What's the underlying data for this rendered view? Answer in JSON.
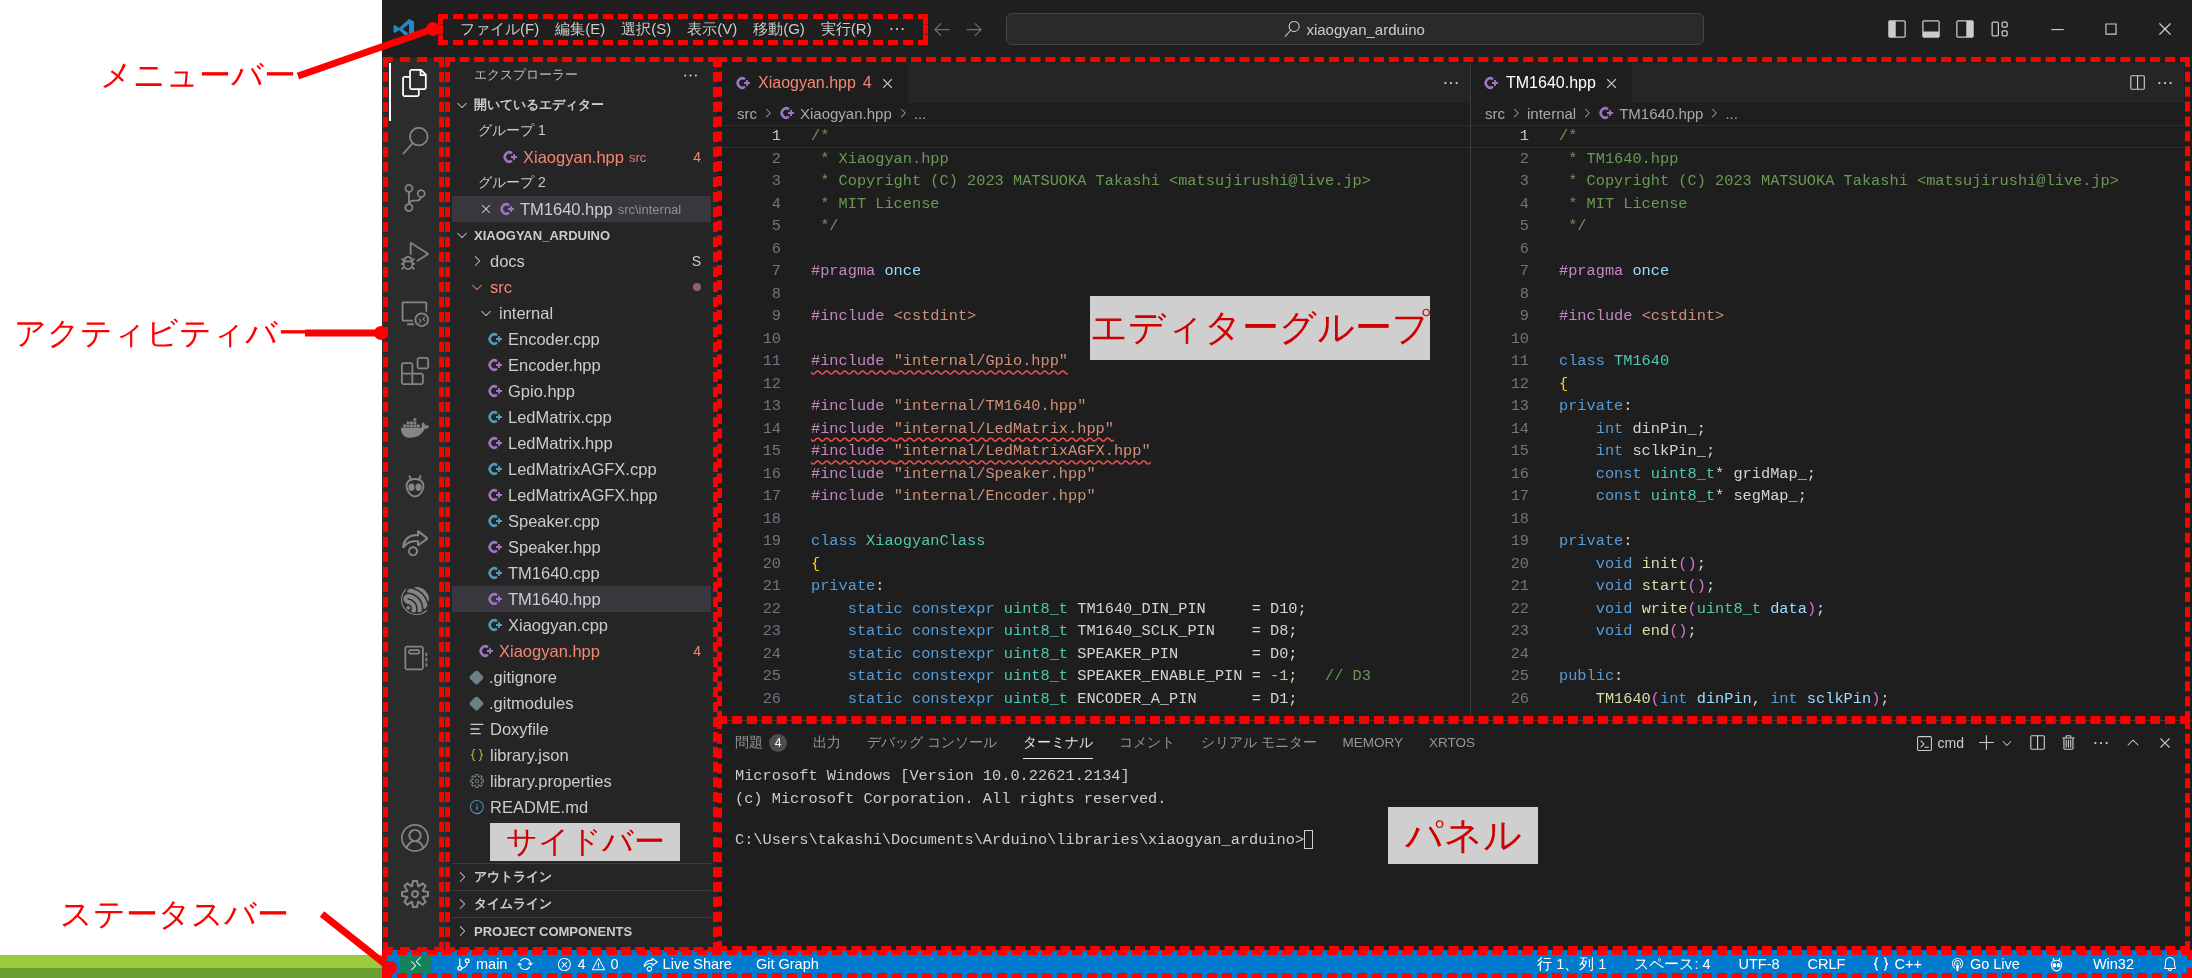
{
  "title_bar": {
    "menu": [
      "ファイル(F)",
      "編集(E)",
      "選択(S)",
      "表示(V)",
      "移動(G)",
      "実行(R)"
    ],
    "search": "xiaogyan_arduino"
  },
  "activity_bar": {
    "items": [
      {
        "kind": "files",
        "selected": true
      },
      {
        "kind": "search",
        "selected": false
      },
      {
        "kind": "scm",
        "selected": false
      },
      {
        "kind": "debug",
        "selected": false
      },
      {
        "kind": "remote",
        "selected": false
      },
      {
        "kind": "extensions",
        "selected": false
      },
      {
        "kind": "docker",
        "selected": false
      },
      {
        "kind": "alien",
        "selected": false
      },
      {
        "kind": "liveshare",
        "selected": false
      },
      {
        "kind": "esp",
        "selected": false
      },
      {
        "kind": "notebook",
        "selected": false
      }
    ],
    "bottom": [
      {
        "kind": "account"
      },
      {
        "kind": "settings"
      }
    ]
  },
  "sidebar": {
    "title": "エクスプローラー",
    "open_editors": {
      "label": "開いているエディター",
      "expanded": true,
      "groups": [
        {
          "label": "グループ 1",
          "files": [
            {
              "name": "Xiaogyan.hpp",
              "kind": "hpp",
              "path": "src",
              "badge": "4",
              "error": true,
              "selected": false
            }
          ]
        },
        {
          "label": "グループ 2",
          "files": [
            {
              "name": "TM1640.hpp",
              "kind": "hpp",
              "path": "src\\internal",
              "error": false,
              "selected": true
            }
          ]
        }
      ]
    },
    "folder": {
      "label": "XIAOGYAN_ARDUINO",
      "expanded": true,
      "children": [
        {
          "name": "docs",
          "kind": "folder",
          "expanded": false,
          "modified": false,
          "error": false,
          "selected": false,
          "badge": "S"
        },
        {
          "name": "src",
          "kind": "folder",
          "expanded": true,
          "modified": true,
          "error": true,
          "selected": false,
          "children": [
            {
              "name": "internal",
              "kind": "folder",
              "expanded": true,
              "modified": false,
              "error": false,
              "selected": false,
              "children": [
                {
                  "name": "Encoder.cpp",
                  "kind": "cpp",
                  "error": false,
                  "selected": false
                },
                {
                  "name": "Encoder.hpp",
                  "kind": "hpp",
                  "error": false,
                  "selected": false
                },
                {
                  "name": "Gpio.hpp",
                  "kind": "hpp",
                  "error": false,
                  "selected": false
                },
                {
                  "name": "LedMatrix.cpp",
                  "kind": "cpp",
                  "error": false,
                  "selected": false
                },
                {
                  "name": "LedMatrix.hpp",
                  "kind": "hpp",
                  "error": false,
                  "selected": false
                },
                {
                  "name": "LedMatrixAGFX.cpp",
                  "kind": "cpp",
                  "error": false,
                  "selected": false
                },
                {
                  "name": "LedMatrixAGFX.hpp",
                  "kind": "hpp",
                  "error": false,
                  "selected": false
                },
                {
                  "name": "Speaker.cpp",
                  "kind": "cpp",
                  "error": false,
                  "selected": false
                },
                {
                  "name": "Speaker.hpp",
                  "kind": "hpp",
                  "error": false,
                  "selected": false
                },
                {
                  "name": "TM1640.cpp",
                  "kind": "cpp",
                  "error": false,
                  "selected": false
                },
                {
                  "name": "TM1640.hpp",
                  "kind": "hpp",
                  "error": false,
                  "selected": true
                },
                {
                  "name": "Xiaogyan.cpp",
                  "kind": "cpp",
                  "error": false,
                  "selected": false
                }
              ]
            },
            {
              "name": "Xiaogyan.hpp",
              "kind": "hpp",
              "error": true,
              "selected": false,
              "badge": "4"
            }
          ]
        },
        {
          "name": ".gitignore",
          "kind": "git",
          "error": false,
          "selected": false
        },
        {
          "name": ".gitmodules",
          "kind": "git",
          "error": false,
          "selected": false
        },
        {
          "name": "Doxyfile",
          "kind": "doc",
          "error": false,
          "selected": false
        },
        {
          "name": "library.json",
          "kind": "json",
          "error": false,
          "selected": false
        },
        {
          "name": "library.properties",
          "kind": "props",
          "error": false,
          "selected": false
        },
        {
          "name": "README.md",
          "kind": "md",
          "error": false,
          "selected": false
        }
      ]
    },
    "sections": [
      {
        "label": "アウトライン",
        "expanded": false
      },
      {
        "label": "タイムライン",
        "expanded": false
      },
      {
        "label": "PROJECT COMPONENTS",
        "expanded": false
      }
    ]
  },
  "editors": [
    {
      "tab": {
        "label": "Xiaogyan.hpp",
        "badge": "4",
        "kind": "hpp",
        "error": true,
        "active": true
      },
      "breadcrumb": [
        {
          "label": "src",
          "kind": "folder"
        },
        {
          "label": "Xiaogyan.hpp",
          "kind": "hpp"
        },
        {
          "label": "...",
          "kind": "more"
        }
      ],
      "lines": [
        {
          "n": "1",
          "current": true,
          "tokens": [
            {
              "kind": "comment",
              "text": "/*"
            }
          ]
        },
        {
          "n": "2",
          "current": false,
          "tokens": [
            {
              "kind": "comment",
              "text": " * Xiaogyan.hpp"
            }
          ]
        },
        {
          "n": "3",
          "current": false,
          "tokens": [
            {
              "kind": "comment",
              "text": " * Copyright (C) 2023 MATSUOKA Takashi <matsujirushi@live.jp>"
            }
          ]
        },
        {
          "n": "4",
          "current": false,
          "tokens": [
            {
              "kind": "comment",
              "text": " * MIT License"
            }
          ]
        },
        {
          "n": "5",
          "current": false,
          "tokens": [
            {
              "kind": "comment",
              "text": " */"
            }
          ]
        },
        {
          "n": "6",
          "current": false
        },
        {
          "n": "7",
          "current": false,
          "tokens": [
            {
              "kind": "dir",
              "text": "#pragma "
            },
            {
              "kind": "kw2",
              "text": "once"
            }
          ]
        },
        {
          "n": "8",
          "current": false
        },
        {
          "n": "9",
          "current": false,
          "tokens": [
            {
              "kind": "dir",
              "text": "#include "
            },
            {
              "kind": "str",
              "text": "<cstdint>"
            }
          ]
        },
        {
          "n": "10",
          "current": false
        },
        {
          "n": "11",
          "current": false,
          "tokens": [
            {
              "kind": "dir_err",
              "text": "#include "
            },
            {
              "kind": "str_err",
              "text": "\"internal/Gpio.hpp\""
            }
          ]
        },
        {
          "n": "12",
          "current": false
        },
        {
          "n": "13",
          "current": false,
          "tokens": [
            {
              "kind": "dir",
              "text": "#include "
            },
            {
              "kind": "str",
              "text": "\"internal/TM1640.hpp\""
            }
          ]
        },
        {
          "n": "14",
          "current": false,
          "tokens": [
            {
              "kind": "dir_err",
              "text": "#include "
            },
            {
              "kind": "str_err",
              "text": "\"internal/LedMatrix.hpp\""
            }
          ]
        },
        {
          "n": "15",
          "current": false,
          "tokens": [
            {
              "kind": "dir_err",
              "text": "#include "
            },
            {
              "kind": "str_err",
              "text": "\"internal/LedMatrixAGFX.hpp\""
            }
          ]
        },
        {
          "n": "16",
          "current": false,
          "tokens": [
            {
              "kind": "dir",
              "text": "#include "
            },
            {
              "kind": "str",
              "text": "\"internal/Speaker.hpp\""
            }
          ]
        },
        {
          "n": "17",
          "current": false,
          "tokens": [
            {
              "kind": "dir",
              "text": "#include "
            },
            {
              "kind": "str",
              "text": "\"internal/Encoder.hpp\""
            }
          ]
        },
        {
          "n": "18",
          "current": false
        },
        {
          "n": "19",
          "current": false,
          "tokens": [
            {
              "kind": "kw",
              "text": "class "
            },
            {
              "kind": "type",
              "text": "XiaogyanClass"
            }
          ]
        },
        {
          "n": "20",
          "current": false,
          "tokens": [
            {
              "kind": "brace",
              "text": "{"
            }
          ]
        },
        {
          "n": "21",
          "current": false,
          "tokens": [
            {
              "kind": "kw",
              "text": "private"
            },
            {
              "kind": "p",
              "text": ":"
            }
          ]
        },
        {
          "n": "22",
          "current": false,
          "tokens": [
            {
              "kind": "kw",
              "text": "    static constexpr "
            },
            {
              "kind": "type",
              "text": "uint8_t"
            },
            {
              "kind": "p",
              "text": " TM1640_DIN_PIN     = D10;"
            }
          ]
        },
        {
          "n": "23",
          "current": false,
          "tokens": [
            {
              "kind": "kw",
              "text": "    static constexpr "
            },
            {
              "kind": "type",
              "text": "uint8_t"
            },
            {
              "kind": "p",
              "text": " TM1640_SCLK_PIN    = D8;"
            }
          ]
        },
        {
          "n": "24",
          "current": false,
          "tokens": [
            {
              "kind": "kw",
              "text": "    static constexpr "
            },
            {
              "kind": "type",
              "text": "uint8_t"
            },
            {
              "kind": "p",
              "text": " SPEAKER_PIN        = D0;"
            }
          ]
        },
        {
          "n": "25",
          "current": false,
          "tokens": [
            {
              "kind": "kw",
              "text": "    static constexpr "
            },
            {
              "kind": "type",
              "text": "uint8_t"
            },
            {
              "kind": "p",
              "text": " SPEAKER_ENABLE_PIN = "
            },
            {
              "kind": "num",
              "text": "-1"
            },
            {
              "kind": "p",
              "text": ";   "
            },
            {
              "kind": "comment",
              "text": "// D3"
            }
          ]
        },
        {
          "n": "26",
          "current": false,
          "tokens": [
            {
              "kind": "kw",
              "text": "    static constexpr "
            },
            {
              "kind": "type",
              "text": "uint8_t"
            },
            {
              "kind": "p",
              "text": " ENCODER_A_PIN      = D1;"
            }
          ]
        }
      ]
    },
    {
      "tab": {
        "label": "TM1640.hpp",
        "kind": "hpp",
        "error": false,
        "active": true
      },
      "breadcrumb": [
        {
          "label": "src",
          "kind": "folder"
        },
        {
          "label": "internal",
          "kind": "folder"
        },
        {
          "label": "TM1640.hpp",
          "kind": "hpp"
        },
        {
          "label": "...",
          "kind": "more"
        }
      ],
      "lines": [
        {
          "n": "1",
          "current": true,
          "tokens": [
            {
              "kind": "comment",
              "text": "/*"
            }
          ]
        },
        {
          "n": "2",
          "current": false,
          "tokens": [
            {
              "kind": "comment",
              "text": " * TM1640.hpp"
            }
          ]
        },
        {
          "n": "3",
          "current": false,
          "tokens": [
            {
              "kind": "comment",
              "text": " * Copyright (C) 2023 MATSUOKA Takashi <matsujirushi@live.jp>"
            }
          ]
        },
        {
          "n": "4",
          "current": false,
          "tokens": [
            {
              "kind": "comment",
              "text": " * MIT License"
            }
          ]
        },
        {
          "n": "5",
          "current": false,
          "tokens": [
            {
              "kind": "comment",
              "text": " */"
            }
          ]
        },
        {
          "n": "6",
          "current": false
        },
        {
          "n": "7",
          "current": false,
          "tokens": [
            {
              "kind": "dir",
              "text": "#pragma "
            },
            {
              "kind": "kw2",
              "text": "once"
            }
          ]
        },
        {
          "n": "8",
          "current": false
        },
        {
          "n": "9",
          "current": false,
          "tokens": [
            {
              "kind": "dir",
              "text": "#include "
            },
            {
              "kind": "str",
              "text": "<cstdint>"
            }
          ]
        },
        {
          "n": "10",
          "current": false
        },
        {
          "n": "11",
          "current": false,
          "tokens": [
            {
              "kind": "kw",
              "text": "class "
            },
            {
              "kind": "type",
              "text": "TM1640"
            }
          ]
        },
        {
          "n": "12",
          "current": false,
          "tokens": [
            {
              "kind": "brace",
              "text": "{"
            }
          ]
        },
        {
          "n": "13",
          "current": false,
          "tokens": [
            {
              "kind": "kw",
              "text": "private"
            },
            {
              "kind": "p",
              "text": ":"
            }
          ]
        },
        {
          "n": "14",
          "current": false,
          "tokens": [
            {
              "kind": "kw",
              "text": "    int"
            },
            {
              "kind": "p",
              "text": " dinPin_;"
            }
          ]
        },
        {
          "n": "15",
          "current": false,
          "tokens": [
            {
              "kind": "kw",
              "text": "    int"
            },
            {
              "kind": "p",
              "text": " sclkPin_;"
            }
          ]
        },
        {
          "n": "16",
          "current": false,
          "tokens": [
            {
              "kind": "kw",
              "text": "    const "
            },
            {
              "kind": "type",
              "text": "uint8_t"
            },
            {
              "kind": "p",
              "text": "* gridMap_;"
            }
          ]
        },
        {
          "n": "17",
          "current": false,
          "tokens": [
            {
              "kind": "kw",
              "text": "    const "
            },
            {
              "kind": "type",
              "text": "uint8_t"
            },
            {
              "kind": "p",
              "text": "* segMap_;"
            }
          ]
        },
        {
          "n": "18",
          "current": false
        },
        {
          "n": "19",
          "current": false,
          "tokens": [
            {
              "kind": "kw",
              "text": "private"
            },
            {
              "kind": "p",
              "text": ":"
            }
          ]
        },
        {
          "n": "20",
          "current": false,
          "tokens": [
            {
              "kind": "kw",
              "text": "    void "
            },
            {
              "kind": "fn",
              "text": "init"
            },
            {
              "kind": "paren",
              "text": "()"
            },
            {
              "kind": "p",
              "text": ";"
            }
          ]
        },
        {
          "n": "21",
          "current": false,
          "tokens": [
            {
              "kind": "kw",
              "text": "    void "
            },
            {
              "kind": "fn",
              "text": "start"
            },
            {
              "kind": "paren",
              "text": "()"
            },
            {
              "kind": "p",
              "text": ";"
            }
          ]
        },
        {
          "n": "22",
          "current": false,
          "tokens": [
            {
              "kind": "kw",
              "text": "    void "
            },
            {
              "kind": "fn",
              "text": "write"
            },
            {
              "kind": "paren",
              "text": "("
            },
            {
              "kind": "type",
              "text": "uint8_t"
            },
            {
              "kind": "var",
              "text": " data"
            },
            {
              "kind": "paren",
              "text": ")"
            },
            {
              "kind": "p",
              "text": ";"
            }
          ]
        },
        {
          "n": "23",
          "current": false,
          "tokens": [
            {
              "kind": "kw",
              "text": "    void "
            },
            {
              "kind": "fn",
              "text": "end"
            },
            {
              "kind": "paren",
              "text": "()"
            },
            {
              "kind": "p",
              "text": ";"
            }
          ]
        },
        {
          "n": "24",
          "current": false
        },
        {
          "n": "25",
          "current": false,
          "tokens": [
            {
              "kind": "kw",
              "text": "public"
            },
            {
              "kind": "p",
              "text": ":"
            }
          ]
        },
        {
          "n": "26",
          "current": false,
          "tokens": [
            {
              "kind": "fn",
              "text": "    TM1640"
            },
            {
              "kind": "paren",
              "text": "("
            },
            {
              "kind": "kw",
              "text": "int "
            },
            {
              "kind": "var",
              "text": "dinPin"
            },
            {
              "kind": "p",
              "text": ", "
            },
            {
              "kind": "kw",
              "text": "int "
            },
            {
              "kind": "var",
              "text": "sclkPin"
            },
            {
              "kind": "paren",
              "text": ")"
            },
            {
              "kind": "p",
              "text": ";"
            }
          ]
        }
      ]
    }
  ],
  "panel": {
    "tabs": [
      {
        "label": "問題",
        "badge": "4",
        "selected": false
      },
      {
        "label": "出力",
        "selected": false
      },
      {
        "label": "デバッグ コンソール",
        "selected": false
      },
      {
        "label": "ターミナル",
        "selected": true
      },
      {
        "label": "コメント",
        "selected": false
      },
      {
        "label": "シリアル モニター",
        "selected": false
      },
      {
        "label": "MEMORY",
        "selected": false
      },
      {
        "label": "XRTOS",
        "selected": false
      }
    ],
    "terminal_name": "cmd",
    "output": [
      "Microsoft Windows [Version 10.0.22621.2134]",
      "(c) Microsoft Corporation. All rights reserved."
    ],
    "prompt": "C:\\Users\\takashi\\Documents\\Arduino\\libraries\\xiaogyan_arduino>"
  },
  "status_bar": {
    "left": [
      {
        "kind": "remote"
      },
      {
        "kind": "branch",
        "label": "main"
      },
      {
        "kind": "sync"
      },
      {
        "kind": "problems",
        "errors": "4",
        "warnings": "0"
      },
      {
        "kind": "liveshare",
        "label": "Live Share"
      },
      {
        "kind": "text",
        "label": "Git Graph"
      }
    ],
    "right": [
      {
        "kind": "text",
        "label": "行 1、列 1"
      },
      {
        "kind": "text",
        "label": "スペース: 4"
      },
      {
        "kind": "text",
        "label": "UTF-8"
      },
      {
        "kind": "text",
        "label": "CRLF"
      },
      {
        "kind": "lang",
        "label": "C++"
      },
      {
        "kind": "golive",
        "label": "Go Live"
      },
      {
        "kind": "alien"
      },
      {
        "kind": "text",
        "label": "Win32"
      },
      {
        "kind": "bell"
      }
    ]
  },
  "annotations": [
    {
      "kind": "menu",
      "label": "メニューバー"
    },
    {
      "kind": "activity",
      "label": "アクティビティバー"
    },
    {
      "kind": "status",
      "label": "ステータスバー"
    },
    {
      "kind": "sidebar",
      "label": "サイドバー"
    },
    {
      "kind": "editors",
      "label": "エディターグループ"
    },
    {
      "kind": "panel",
      "label": "パネル"
    }
  ]
}
